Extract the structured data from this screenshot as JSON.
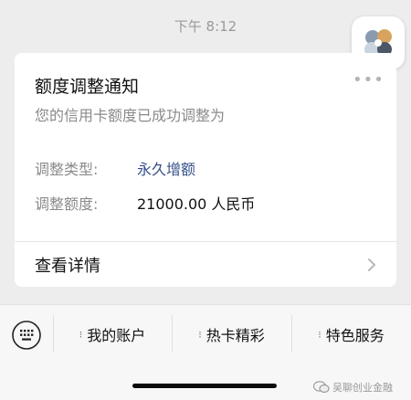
{
  "status": {
    "time": "下午 8:12"
  },
  "card": {
    "title": "额度调整通知",
    "subtitle": "您的信用卡额度已成功调整为",
    "more_icon": "more-dots-icon",
    "fields": [
      {
        "label": "调整类型:",
        "value": "永久增额"
      },
      {
        "label": "调整额度:",
        "value": "21000.00 人民币"
      }
    ],
    "details_label": "查看详情",
    "details_icon": "chevron-right-icon"
  },
  "menu": {
    "keyboard_icon": "keyboard-icon",
    "items": [
      {
        "label": "我的账户"
      },
      {
        "label": "热卡精彩"
      },
      {
        "label": "特色服务"
      }
    ]
  },
  "watermark": {
    "text": "吴聊创业金融"
  },
  "colors": {
    "link": "#35508a",
    "bg": "#ededed",
    "card": "#ffffff"
  }
}
